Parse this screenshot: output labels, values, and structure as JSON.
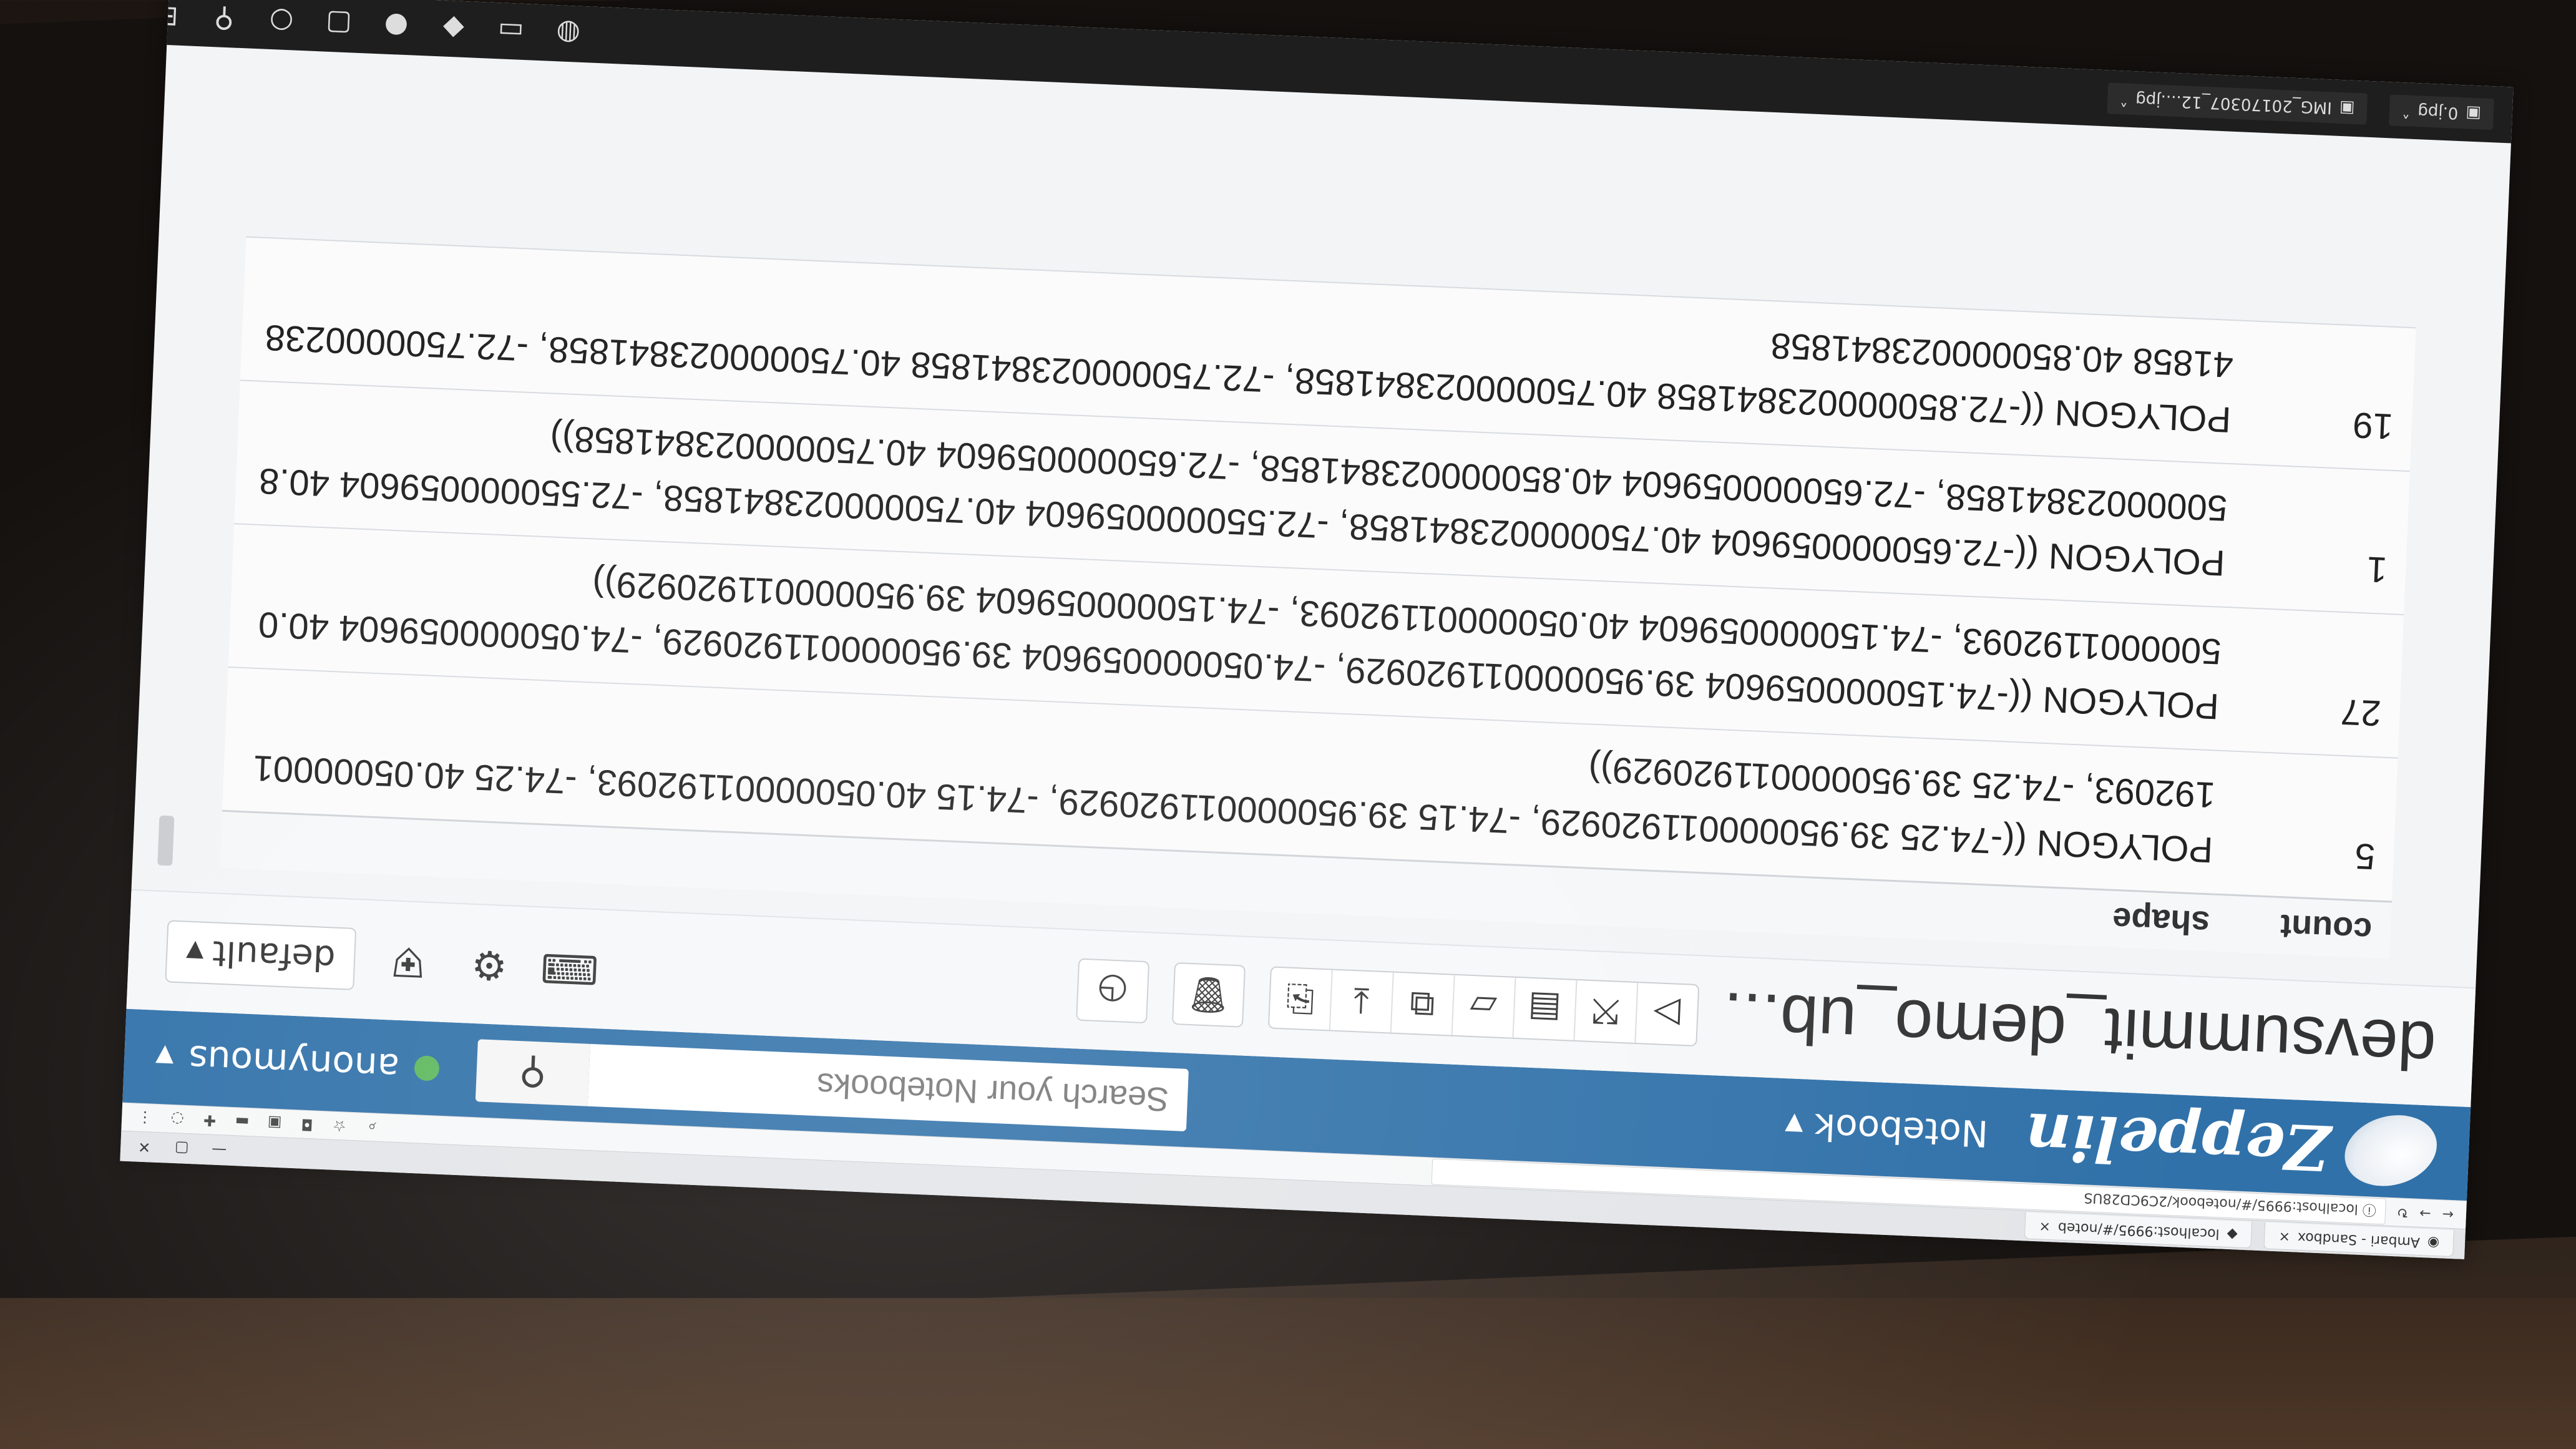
{
  "browser": {
    "tabs": [
      {
        "label": "Ambari - Sandbox"
      },
      {
        "label": "localhost:9995/#/noteb"
      }
    ],
    "address": "localhost:9995/#/notebook/2C9CD28US",
    "window_controls": {
      "minimize": "—",
      "restore": "▢",
      "close": "✕"
    }
  },
  "navbar": {
    "brand": "Zeppelin",
    "notebook_menu": "Notebook",
    "search_placeholder": "Search your Notebooks",
    "user": "anonymous",
    "status_color": "#5cb85c",
    "bar_color": "#3071a9"
  },
  "notebook": {
    "title": "devsummit_demo_ub...",
    "default_label": "default",
    "icons": [
      "run-all-icon",
      "show-hide-code-icon",
      "show-hide-output-icon",
      "clear-output-icon",
      "clone-icon",
      "export-icon",
      "version-control-icon",
      "delete-icon",
      "scheduler-icon",
      "keyboard-shortcuts-icon",
      "interpreter-binding-icon",
      "permissions-icon"
    ]
  },
  "table": {
    "columns": [
      "count",
      "shape"
    ],
    "rows": [
      {
        "count": "5",
        "shape": "POLYGON ((-74.25 39.950000011920929, -74.15 39.950000011920929, -74.15 40.05000001192093, -74.25 40.05000001192093, -74.25 39.950000011920929))"
      },
      {
        "count": "27",
        "shape": "POLYGON ((-74.150000059604 39.950000011920929, -74.050000059604 39.950000011920929, -74.050000059604 40.05000001192093, -74.150000059604 40.05000001192093, -74.150000059604 39.950000011920929))"
      },
      {
        "count": "1",
        "shape": "POLYGON ((-72.650000059604 40.750000023841858, -72.550000059604 40.750000023841858, -72.550000059604 40.850000023841858, -72.650000059604 40.850000023841858, -72.650000059604 40.750000023841858))"
      },
      {
        "count": "19",
        "shape": "POLYGON ((-72.850000023841858 40.750000023841858, -72.750000023841858 40.750000023841858, -72.750000023841858 40.850000023841858"
      }
    ]
  },
  "taskbar": {
    "downloads": [
      {
        "label": "0.jpg"
      },
      {
        "label": "IMG_20170307_12....jpg"
      }
    ]
  }
}
